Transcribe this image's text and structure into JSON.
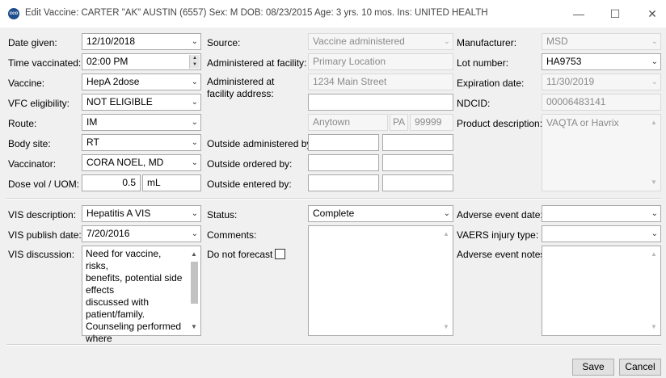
{
  "window": {
    "title": "Edit Vaccine: CARTER \"AK\" AUSTIN (6557)  Sex: M  DOB: 08/23/2015  Age: 3 yrs. 10 mos.  Ins: UNITED HEALTH",
    "app_icon_text": "cco",
    "controls": {
      "minimize": "—",
      "maximize": "☐",
      "close": "✕"
    }
  },
  "left": {
    "date_given": {
      "label": "Date given:",
      "value": "12/10/2018"
    },
    "time_vaccinated": {
      "label": "Time vaccinated:",
      "value": "02:00 PM"
    },
    "vaccine": {
      "label": "Vaccine:",
      "value": "HepA 2dose"
    },
    "vfc": {
      "label": "VFC eligibility:",
      "value": "NOT ELIGIBLE"
    },
    "route": {
      "label": "Route:",
      "value": "IM"
    },
    "body_site": {
      "label": "Body site:",
      "value": "RT"
    },
    "vaccinator": {
      "label": "Vaccinator:",
      "value": "CORA NOEL, MD"
    },
    "dose": {
      "label": "Dose vol / UOM:",
      "value": "0.5",
      "uom": "mL"
    }
  },
  "middle": {
    "source": {
      "label": "Source:",
      "value": "Vaccine administered"
    },
    "facility": {
      "label": "Administered at facility:",
      "value": "Primary Location"
    },
    "facility_address": {
      "label": "Administered at facility address:",
      "line1": "1234 Main Street",
      "line2": "",
      "city": "Anytown",
      "state": "PA",
      "zip": "99999"
    },
    "outside_administered": {
      "label": "Outside administered by:"
    },
    "outside_ordered": {
      "label": "Outside ordered by:"
    },
    "outside_entered": {
      "label": "Outside entered by:"
    }
  },
  "right": {
    "manufacturer": {
      "label": "Manufacturer:",
      "value": "MSD"
    },
    "lot": {
      "label": "Lot number:",
      "value": "HA9753"
    },
    "expiration": {
      "label": "Expiration date:",
      "value": "11/30/2019"
    },
    "ndcid": {
      "label": "NDCID:",
      "value": "00006483141"
    },
    "product": {
      "label": "Product description:",
      "value": "VAQTA or Havrix"
    }
  },
  "vis": {
    "description": {
      "label": "VIS description:",
      "value": "Hepatitis A VIS"
    },
    "publish_date": {
      "label": "VIS publish date:",
      "value": "7/20/2016"
    },
    "discussion": {
      "label": "VIS discussion:",
      "value": "Need for vaccine, risks,\nbenefits, potential side\neffects\ndiscussed with\npatient/family.\nCounseling performed\nwhere"
    }
  },
  "status": {
    "status": {
      "label": "Status:",
      "value": "Complete"
    },
    "comments": {
      "label": "Comments:",
      "value": ""
    },
    "do_not_forecast": {
      "label": "Do not forecast",
      "checked": false
    }
  },
  "adverse": {
    "date": {
      "label": "Adverse event date:",
      "value": ""
    },
    "vaers": {
      "label": "VAERS injury type:",
      "value": ""
    },
    "notes": {
      "label": "Adverse event notes:",
      "value": ""
    }
  },
  "buttons": {
    "save": "Save",
    "cancel": "Cancel"
  }
}
